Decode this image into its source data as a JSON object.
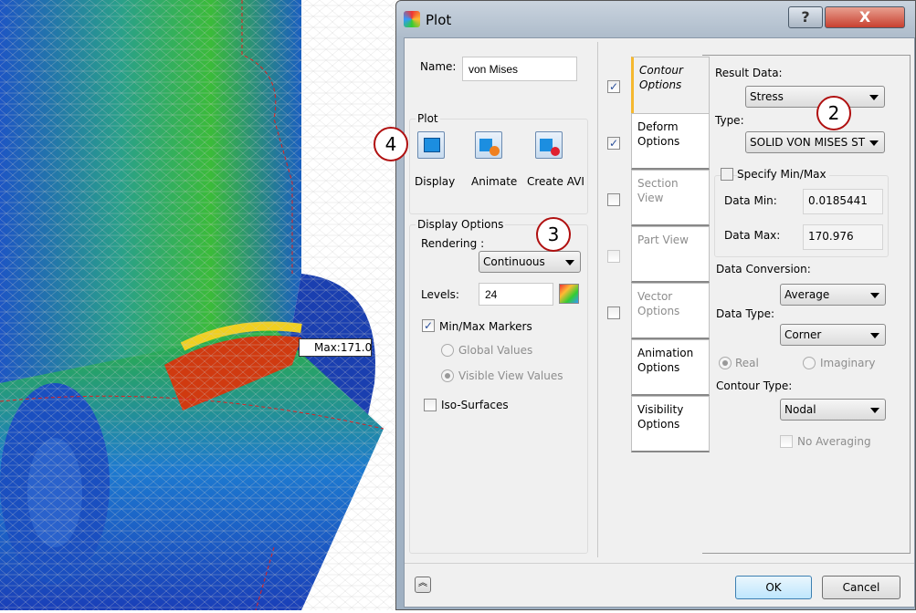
{
  "viewport": {
    "max_marker": "Max:171.0"
  },
  "dialog": {
    "title": "Plot",
    "help_label": "?",
    "close_label": "X"
  },
  "name": {
    "label": "Name:",
    "value": "von Mises"
  },
  "plot_group": {
    "title": "Plot",
    "buttons": [
      {
        "label": "Display",
        "icon": "display-icon"
      },
      {
        "label": "Animate",
        "icon": "animate-icon"
      },
      {
        "label": "Create AVI",
        "icon": "create-avi-icon"
      }
    ]
  },
  "display_options": {
    "title": "Display Options",
    "rendering_label": "Rendering :",
    "rendering_value": "Continuous",
    "levels_label": "Levels:",
    "levels_value": "24",
    "minmax_label": "Min/Max Markers",
    "minmax_checked": true,
    "global_label": "Global Values",
    "visible_label": "Visible View Values",
    "iso_label": "Iso-Surfaces",
    "iso_checked": false
  },
  "tabs": [
    {
      "line1": "Contour",
      "line2": "Options",
      "checked": true,
      "active": true
    },
    {
      "line1": "Deform",
      "line2": "Options",
      "checked": true
    },
    {
      "line1": "Section View",
      "line2": "",
      "checked": false,
      "disabled": true
    },
    {
      "line1": "Part View",
      "line2": "",
      "checked": false,
      "disabled": true
    },
    {
      "line1": "Vector",
      "line2": "Options",
      "checked": false,
      "disabled": true
    },
    {
      "line1": "Animation",
      "line2": "Options"
    },
    {
      "line1": "Visibility",
      "line2": "Options"
    }
  ],
  "contour": {
    "result_label": "Result Data:",
    "result_value": "Stress",
    "type_label": "Type:",
    "type_value": "SOLID VON MISES ST",
    "specify_label": "Specify Min/Max",
    "min_label": "Data Min:",
    "min_value": "0.0185441",
    "max_label": "Data Max:",
    "max_value": "170.976",
    "conv_label": "Data Conversion:",
    "conv_value": "Average",
    "dtype_label": "Data Type:",
    "dtype_value": "Corner",
    "real_label": "Real",
    "imag_label": "Imaginary",
    "ctype_label": "Contour Type:",
    "ctype_value": "Nodal",
    "noavg_label": "No Averaging"
  },
  "callouts": [
    "2",
    "3",
    "4"
  ],
  "footer": {
    "ok": "OK",
    "cancel": "Cancel",
    "expand_icon": "double-chevron-up-icon"
  },
  "colors": {
    "accent_tab": "#f5b830",
    "callout": "#b01010"
  }
}
